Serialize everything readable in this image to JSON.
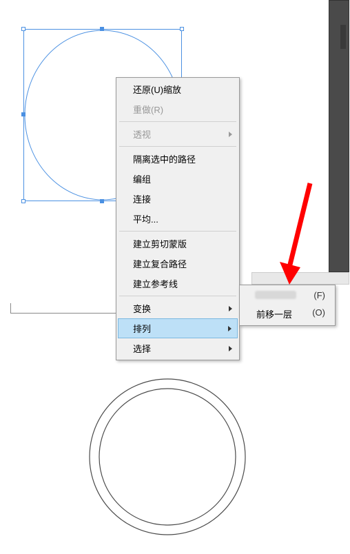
{
  "menu": {
    "undo": "还原(U)缩放",
    "redo": "重做(R)",
    "perspective": "透视",
    "isolate": "隔离选中的路径",
    "ungroup": "编组",
    "join": "连接",
    "average": "平均...",
    "clipmask": "建立剪切蒙版",
    "compound": "建立复合路径",
    "guides": "建立参考线",
    "transform": "变换",
    "arrange": "排列",
    "select": "选择"
  },
  "submenu": {
    "front_shortcut": "(F)",
    "forward": "前移一层",
    "forward_shortcut": "(O)"
  }
}
